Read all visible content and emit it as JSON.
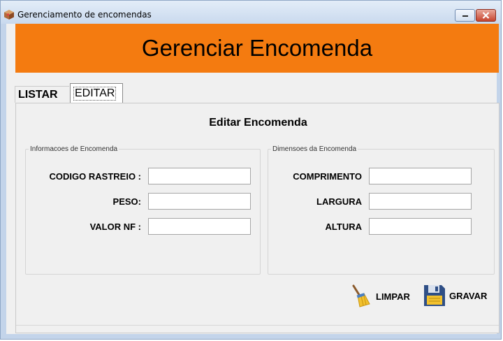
{
  "window": {
    "title": "Gerenciamento de encomendas"
  },
  "banner": {
    "title": "Gerenciar Encomenda"
  },
  "tabs": [
    {
      "label": "LISTAR"
    },
    {
      "label": "EDITAR"
    }
  ],
  "form": {
    "title": "Editar Encomenda",
    "left_group": {
      "legend": "Informacoes de Encomenda",
      "fields": [
        {
          "label": "CODIGO RASTREIO :",
          "value": ""
        },
        {
          "label": "PESO:",
          "value": ""
        },
        {
          "label": "VALOR NF :",
          "value": ""
        }
      ]
    },
    "right_group": {
      "legend": "Dimensoes da Encomenda",
      "fields": [
        {
          "label": "COMPRIMENTO",
          "value": ""
        },
        {
          "label": "LARGURA",
          "value": ""
        },
        {
          "label": "ALTURA",
          "value": ""
        }
      ]
    }
  },
  "buttons": {
    "clear": "LIMPAR",
    "save": "GRAVAR"
  },
  "icons": {
    "app": "package-icon",
    "clear": "broom-icon",
    "save": "floppy-disk-icon"
  },
  "colors": {
    "banner": "#f47b10",
    "close_button": "#c7452f"
  }
}
